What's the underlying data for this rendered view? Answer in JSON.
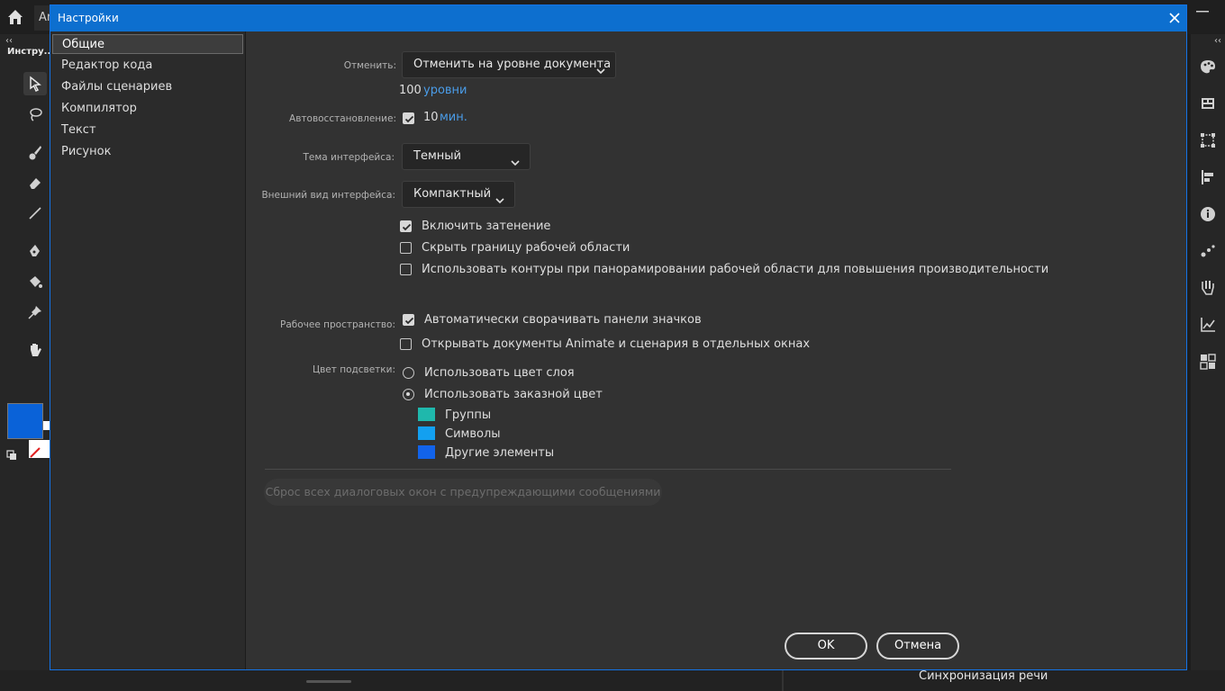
{
  "app": {
    "tab_label": "An",
    "toolbar_title": "Инстру...",
    "toolbar_collapse": "‹‹",
    "panel_collapse": "‹‹",
    "bottom_text": "Синхронизация речи",
    "stroke_color": "#0a62d8"
  },
  "dialog": {
    "title": "Настройки",
    "sidebar": {
      "items": [
        {
          "label": "Общие",
          "active": true
        },
        {
          "label": "Редактор кода",
          "active": false
        },
        {
          "label": "Файлы сценариев",
          "active": false
        },
        {
          "label": "Компилятор",
          "active": false
        },
        {
          "label": "Текст",
          "active": false
        },
        {
          "label": "Рисунок",
          "active": false
        }
      ]
    },
    "undo": {
      "label": "Отменить:",
      "value": "Отменить на уровне документа",
      "levels_value": "100",
      "levels_unit": "уровни"
    },
    "autorecovery": {
      "label": "Автовосстановление:",
      "checked": true,
      "value": "10",
      "unit": "мин."
    },
    "theme": {
      "label": "Тема интерфейса:",
      "value": "Темный"
    },
    "appearance": {
      "label": "Внешний вид интерфейса:",
      "value": "Компактный"
    },
    "options": {
      "enable_shading": {
        "label": "Включить затенение",
        "checked": true
      },
      "hide_stage_border": {
        "label": "Скрыть границу рабочей области",
        "checked": false
      },
      "use_outlines": {
        "label": "Использовать контуры при панорамировании рабочей области для повышения производительности",
        "checked": false
      }
    },
    "workspace": {
      "label": "Рабочее пространство:",
      "auto_collapse": {
        "label": "Автоматически сворачивать панели значков",
        "checked": true
      },
      "open_separate": {
        "label": "Открывать документы Animate и сценария в отдельных окнах",
        "checked": false
      }
    },
    "highlight": {
      "label": "Цвет подсветки:",
      "use_layer_color": {
        "label": "Использовать цвет слоя",
        "selected": false
      },
      "use_custom_color": {
        "label": "Использовать заказной цвет",
        "selected": true
      },
      "colors": [
        {
          "label": "Группы",
          "color": "#1fb8ac"
        },
        {
          "label": "Символы",
          "color": "#13a0f0"
        },
        {
          "label": "Другие элементы",
          "color": "#1263ea"
        }
      ]
    },
    "reset_button": "Сброс всех диалоговых окон с предупреждающими сообщениями",
    "ok_button": "OK",
    "cancel_button": "Отмена"
  }
}
